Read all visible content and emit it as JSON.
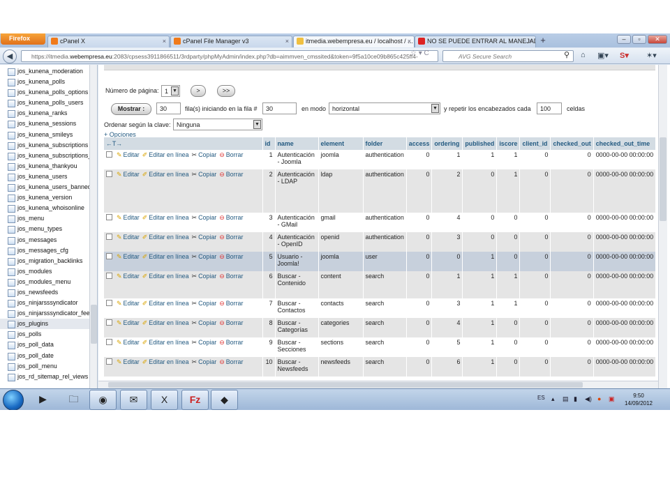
{
  "browser": {
    "firefox_button": "Firefox",
    "tabs": [
      {
        "label": "cPanel X"
      },
      {
        "label": "cPanel File Manager v3"
      },
      {
        "label": "itmedia.webempresa.eu / localhost / ..."
      },
      {
        "label": "NO SE PUEDE ENTRAR AL MANEJAD..."
      }
    ],
    "new_tab": "+",
    "url_prefix": "https://itmedia.",
    "url_host": "webempresa.eu",
    "url_rest": ":2083/cpsess3911866511/3rdparty/phpMyAdmin/index.php?db=aimmven_cmssited&token=9f5a10ce09b865c425ff4-",
    "search_placeholder": "AVG Secure Search"
  },
  "sidebar": {
    "items": [
      "jos_kunena_moderation",
      "jos_kunena_polls",
      "jos_kunena_polls_options",
      "jos_kunena_polls_users",
      "jos_kunena_ranks",
      "jos_kunena_sessions",
      "jos_kunena_smileys",
      "jos_kunena_subscriptions",
      "jos_kunena_subscriptions_categories",
      "jos_kunena_thankyou",
      "jos_kunena_users",
      "jos_kunena_users_banned",
      "jos_kunena_version",
      "jos_kunena_whoisonline",
      "jos_menu",
      "jos_menu_types",
      "jos_messages",
      "jos_messages_cfg",
      "jos_migration_backlinks",
      "jos_modules",
      "jos_modules_menu",
      "jos_newsfeeds",
      "jos_ninjarsssyndicator",
      "jos_ninjarsssyndicator_feeds",
      "jos_plugins",
      "jos_polls",
      "jos_poll_data",
      "jos_poll_date",
      "jos_poll_menu",
      "jos_rd_sitemap_rel_views"
    ],
    "selected_index": 24
  },
  "controls": {
    "page_label": "Número de página:",
    "page_value": "1",
    "next_label": ">",
    "last_label": ">>",
    "show_button": "Mostrar :",
    "rows_value": "30",
    "rows_label": "fila(s) iniciando en la fila #",
    "start_value": "30",
    "mode_label": "en modo",
    "mode_value": "horizontal",
    "repeat_label": "y repetir los encabezados cada",
    "repeat_value": "100",
    "cells_label": "celdas",
    "order_label": "Ordenar según la clave:",
    "order_value": "Ninguna",
    "options_link": "+ Opciones",
    "arrows": "←T→"
  },
  "table": {
    "columns": [
      "id",
      "name",
      "element",
      "folder",
      "access",
      "ordering",
      "published",
      "iscore",
      "client_id",
      "checked_out",
      "checked_out_time"
    ],
    "actions": {
      "edit": "Editar",
      "inline": "Editar en línea",
      "copy": "Copiar",
      "delete": "Borrar"
    },
    "rows": [
      {
        "id": "1",
        "name": "Autenticación - Joomla",
        "element": "joomla",
        "folder": "authentication",
        "access": "0",
        "ordering": "1",
        "published": "1",
        "iscore": "1",
        "client_id": "0",
        "checked_out": "0",
        "checked_out_time": "0000-00-00 00:00:00"
      },
      {
        "id": "2",
        "name": "Autenticación - LDAP",
        "element": "ldap",
        "folder": "authentication",
        "access": "0",
        "ordering": "2",
        "published": "0",
        "iscore": "1",
        "client_id": "0",
        "checked_out": "0",
        "checked_out_time": "0000-00-00 00:00:00"
      },
      {
        "id": "3",
        "name": "Autenticación - GMail",
        "element": "gmail",
        "folder": "authentication",
        "access": "0",
        "ordering": "4",
        "published": "0",
        "iscore": "0",
        "client_id": "0",
        "checked_out": "0",
        "checked_out_time": "0000-00-00 00:00:00"
      },
      {
        "id": "4",
        "name": "Autenticación - OpenID",
        "element": "openid",
        "folder": "authentication",
        "access": "0",
        "ordering": "3",
        "published": "0",
        "iscore": "0",
        "client_id": "0",
        "checked_out": "0",
        "checked_out_time": "0000-00-00 00:00:00"
      },
      {
        "id": "5",
        "name": "Usuario - Joomla!",
        "element": "joomla",
        "folder": "user",
        "access": "0",
        "ordering": "0",
        "published": "1",
        "iscore": "0",
        "client_id": "0",
        "checked_out": "0",
        "checked_out_time": "0000-00-00 00:00:00"
      },
      {
        "id": "6",
        "name": "Buscar - Contenido",
        "element": "content",
        "folder": "search",
        "access": "0",
        "ordering": "1",
        "published": "1",
        "iscore": "1",
        "client_id": "0",
        "checked_out": "0",
        "checked_out_time": "0000-00-00 00:00:00"
      },
      {
        "id": "7",
        "name": "Buscar - Contactos",
        "element": "contacts",
        "folder": "search",
        "access": "0",
        "ordering": "3",
        "published": "1",
        "iscore": "1",
        "client_id": "0",
        "checked_out": "0",
        "checked_out_time": "0000-00-00 00:00:00"
      },
      {
        "id": "8",
        "name": "Buscar - Categorías",
        "element": "categories",
        "folder": "search",
        "access": "0",
        "ordering": "4",
        "published": "1",
        "iscore": "0",
        "client_id": "0",
        "checked_out": "0",
        "checked_out_time": "0000-00-00 00:00:00"
      },
      {
        "id": "9",
        "name": "Buscar - Secciones",
        "element": "sections",
        "folder": "search",
        "access": "0",
        "ordering": "5",
        "published": "1",
        "iscore": "0",
        "client_id": "0",
        "checked_out": "0",
        "checked_out_time": "0000-00-00 00:00:00"
      },
      {
        "id": "10",
        "name": "Buscar - Newsfeeds",
        "element": "newsfeeds",
        "folder": "search",
        "access": "0",
        "ordering": "6",
        "published": "1",
        "iscore": "0",
        "client_id": "0",
        "checked_out": "0",
        "checked_out_time": "0000-00-00 00:00:00"
      }
    ]
  },
  "taskbar": {
    "lang": "ES",
    "time": "9:50",
    "date": "14/09/2012"
  }
}
